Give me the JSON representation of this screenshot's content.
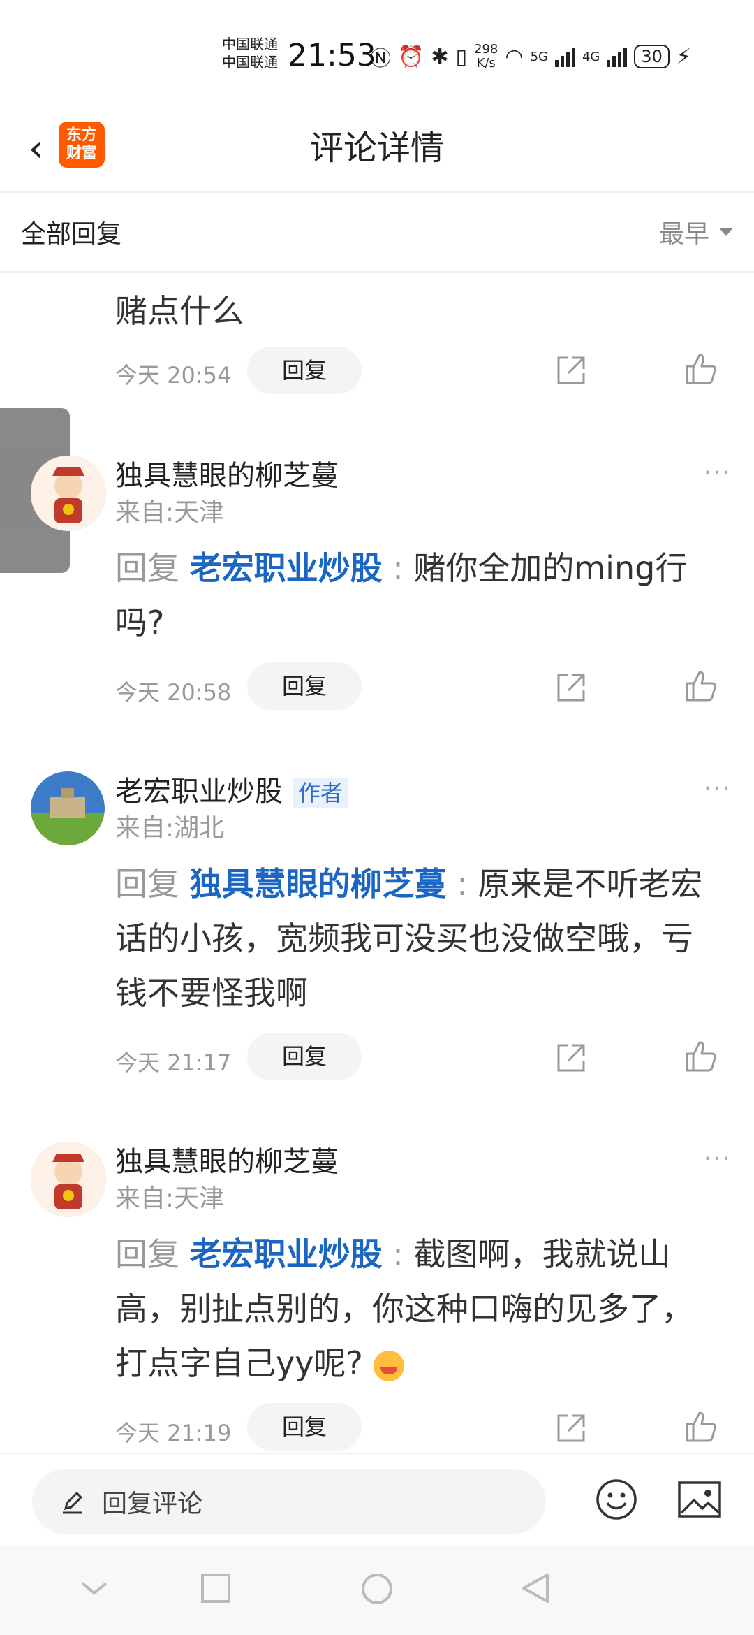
{
  "status": {
    "carrier1": "中国联通",
    "carrier2": "中国联通",
    "time": "21:53",
    "speed_top": "298",
    "speed_bottom": "K/s",
    "net1": "5G",
    "net2": "4G",
    "battery": "30"
  },
  "header": {
    "back": "‹",
    "logo_line1": "东方",
    "logo_line2": "财富",
    "title": "评论详情"
  },
  "filter": {
    "label": "全部回复",
    "sort": "最早"
  },
  "comments": [
    {
      "text": "赌点什么",
      "time": "今天 20:54",
      "reply": "回复"
    },
    {
      "name": "独具慧眼的柳芝蔓",
      "location": "来自:天津",
      "reply_prefix": "回复 ",
      "mention": "老宏职业炒股",
      "colon": " : ",
      "text": "赌你全加的ming行吗?",
      "time": "今天 20:58",
      "reply": "回复"
    },
    {
      "name": "老宏职业炒股",
      "badge": "作者",
      "location": "来自:湖北",
      "reply_prefix": "回复 ",
      "mention": "独具慧眼的柳芝蔓",
      "colon": " : ",
      "text": "原来是不听老宏话的小孩，宽频我可没买也没做空哦，亏钱不要怪我啊",
      "time": "今天 21:17",
      "reply": "回复"
    },
    {
      "name": "独具慧眼的柳芝蔓",
      "location": "来自:天津",
      "reply_prefix": "回复 ",
      "mention": "老宏职业炒股",
      "colon": " : ",
      "text": "截图啊，我就说山高，别扯点别的，你这种口嗨的见多了，打点字自己yy呢?",
      "time": "今天 21:19",
      "reply": "回复"
    }
  ],
  "more": "···",
  "side_tab": "›",
  "bottom": {
    "placeholder": "回复评论"
  },
  "colors": {
    "accent": "#1a66c2",
    "brand": "#ff5a00"
  }
}
